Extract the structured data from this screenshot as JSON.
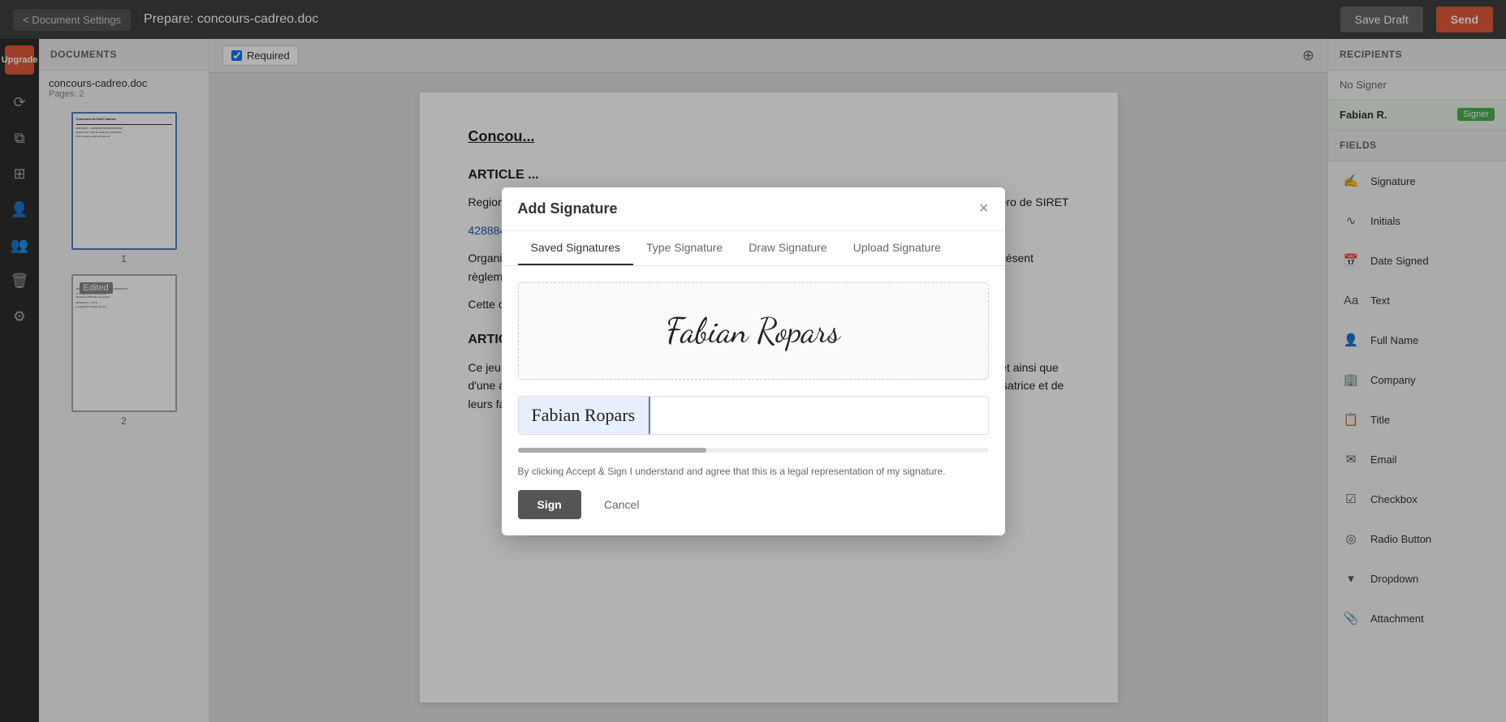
{
  "topbar": {
    "back_label": "< Document Settings",
    "title": "Prepare: concours-cadreo.doc",
    "save_draft_label": "Save Draft",
    "send_label": "Send"
  },
  "sidebar": {
    "upgrade_label": "Upgrade"
  },
  "documents_panel": {
    "header": "DOCUMENTS",
    "doc_name": "concours-cadreo.doc",
    "doc_pages": "Pages: 2",
    "page1_label": "1",
    "page2_label": "2",
    "edited_badge": "Edited"
  },
  "toolbar": {
    "required_label": "Required",
    "zoom_icon": "⊕"
  },
  "doc_content": {
    "heading1": "Concou...",
    "article1_heading": "ARTICLE ...",
    "article1_text1": "RegionsJo... numéro de SIRET",
    "article1_link": "428884313...",
    "organise_text": "Organise d... : « Concours de Noël » (ci-après dénommé « le jeu »), selon les modalités décrites dans le présent règlement.",
    "facebook_text": "Cette opération n'est ni organisée, ni parrainée par Facebook, Google, Apple ou Microsoft.",
    "article2_heading": "ARTICLE 2 – CONDITIONS DE PARTICIPATION",
    "article2_text": "Ce jeu gratuit est ouvert à toute personne physique âgée de plus de 18 ans, disposant d'un accès à internet ainsi que d'une adresse électronique valide, et résidant en France, à l'exception des personnels de la société organisatrice et de leurs familles, ainsi que de toutes personnes ayant participé à l'élaboration du jeu."
  },
  "recipients": {
    "header": "RECIPIENTS",
    "no_signer_label": "No Signer",
    "signer_name": "Fabian R.",
    "signer_badge": "Signer"
  },
  "fields": {
    "header": "FIELDS",
    "items": [
      {
        "label": "Signature",
        "icon": "✍"
      },
      {
        "label": "Initials",
        "icon": "∿"
      },
      {
        "label": "Date Signed",
        "icon": "▦"
      },
      {
        "label": "Text",
        "icon": "Aa"
      },
      {
        "label": "Full Name",
        "icon": "👤"
      },
      {
        "label": "Company",
        "icon": "▣"
      },
      {
        "label": "Title",
        "icon": "▣"
      },
      {
        "label": "Email",
        "icon": "✉"
      },
      {
        "label": "Checkbox",
        "icon": "☑"
      },
      {
        "label": "Radio Button",
        "icon": "◎"
      },
      {
        "label": "Dropdown",
        "icon": "▣"
      },
      {
        "label": "Attachment",
        "icon": "📎"
      }
    ]
  },
  "modal": {
    "title": "Add Signature",
    "close_icon": "×",
    "tabs": [
      {
        "label": "Saved Signatures",
        "active": true
      },
      {
        "label": "Type Signature",
        "active": false
      },
      {
        "label": "Draw Signature",
        "active": false
      },
      {
        "label": "Upload Signature",
        "active": false
      }
    ],
    "signature_display": "Fabian Ropars",
    "sig_option": "Fabian Ropars",
    "legal_text": "By clicking Accept & Sign I understand and agree that this is a legal representation of my signature.",
    "sign_label": "Sign",
    "cancel_label": "Cancel"
  }
}
